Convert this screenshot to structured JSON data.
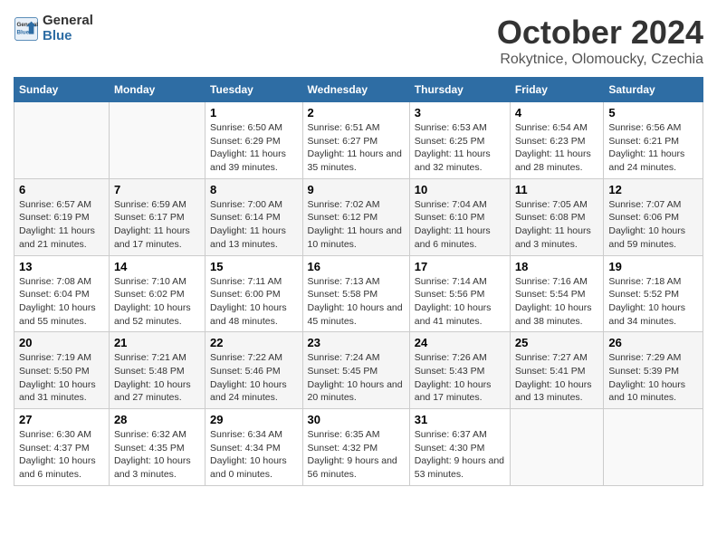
{
  "logo": {
    "line1": "General",
    "line2": "Blue"
  },
  "title": "October 2024",
  "subtitle": "Rokytnice, Olomoucky, Czechia",
  "days_of_week": [
    "Sunday",
    "Monday",
    "Tuesday",
    "Wednesday",
    "Thursday",
    "Friday",
    "Saturday"
  ],
  "weeks": [
    [
      {
        "day": "",
        "info": ""
      },
      {
        "day": "",
        "info": ""
      },
      {
        "day": "1",
        "info": "Sunrise: 6:50 AM\nSunset: 6:29 PM\nDaylight: 11 hours and 39 minutes."
      },
      {
        "day": "2",
        "info": "Sunrise: 6:51 AM\nSunset: 6:27 PM\nDaylight: 11 hours and 35 minutes."
      },
      {
        "day": "3",
        "info": "Sunrise: 6:53 AM\nSunset: 6:25 PM\nDaylight: 11 hours and 32 minutes."
      },
      {
        "day": "4",
        "info": "Sunrise: 6:54 AM\nSunset: 6:23 PM\nDaylight: 11 hours and 28 minutes."
      },
      {
        "day": "5",
        "info": "Sunrise: 6:56 AM\nSunset: 6:21 PM\nDaylight: 11 hours and 24 minutes."
      }
    ],
    [
      {
        "day": "6",
        "info": "Sunrise: 6:57 AM\nSunset: 6:19 PM\nDaylight: 11 hours and 21 minutes."
      },
      {
        "day": "7",
        "info": "Sunrise: 6:59 AM\nSunset: 6:17 PM\nDaylight: 11 hours and 17 minutes."
      },
      {
        "day": "8",
        "info": "Sunrise: 7:00 AM\nSunset: 6:14 PM\nDaylight: 11 hours and 13 minutes."
      },
      {
        "day": "9",
        "info": "Sunrise: 7:02 AM\nSunset: 6:12 PM\nDaylight: 11 hours and 10 minutes."
      },
      {
        "day": "10",
        "info": "Sunrise: 7:04 AM\nSunset: 6:10 PM\nDaylight: 11 hours and 6 minutes."
      },
      {
        "day": "11",
        "info": "Sunrise: 7:05 AM\nSunset: 6:08 PM\nDaylight: 11 hours and 3 minutes."
      },
      {
        "day": "12",
        "info": "Sunrise: 7:07 AM\nSunset: 6:06 PM\nDaylight: 10 hours and 59 minutes."
      }
    ],
    [
      {
        "day": "13",
        "info": "Sunrise: 7:08 AM\nSunset: 6:04 PM\nDaylight: 10 hours and 55 minutes."
      },
      {
        "day": "14",
        "info": "Sunrise: 7:10 AM\nSunset: 6:02 PM\nDaylight: 10 hours and 52 minutes."
      },
      {
        "day": "15",
        "info": "Sunrise: 7:11 AM\nSunset: 6:00 PM\nDaylight: 10 hours and 48 minutes."
      },
      {
        "day": "16",
        "info": "Sunrise: 7:13 AM\nSunset: 5:58 PM\nDaylight: 10 hours and 45 minutes."
      },
      {
        "day": "17",
        "info": "Sunrise: 7:14 AM\nSunset: 5:56 PM\nDaylight: 10 hours and 41 minutes."
      },
      {
        "day": "18",
        "info": "Sunrise: 7:16 AM\nSunset: 5:54 PM\nDaylight: 10 hours and 38 minutes."
      },
      {
        "day": "19",
        "info": "Sunrise: 7:18 AM\nSunset: 5:52 PM\nDaylight: 10 hours and 34 minutes."
      }
    ],
    [
      {
        "day": "20",
        "info": "Sunrise: 7:19 AM\nSunset: 5:50 PM\nDaylight: 10 hours and 31 minutes."
      },
      {
        "day": "21",
        "info": "Sunrise: 7:21 AM\nSunset: 5:48 PM\nDaylight: 10 hours and 27 minutes."
      },
      {
        "day": "22",
        "info": "Sunrise: 7:22 AM\nSunset: 5:46 PM\nDaylight: 10 hours and 24 minutes."
      },
      {
        "day": "23",
        "info": "Sunrise: 7:24 AM\nSunset: 5:45 PM\nDaylight: 10 hours and 20 minutes."
      },
      {
        "day": "24",
        "info": "Sunrise: 7:26 AM\nSunset: 5:43 PM\nDaylight: 10 hours and 17 minutes."
      },
      {
        "day": "25",
        "info": "Sunrise: 7:27 AM\nSunset: 5:41 PM\nDaylight: 10 hours and 13 minutes."
      },
      {
        "day": "26",
        "info": "Sunrise: 7:29 AM\nSunset: 5:39 PM\nDaylight: 10 hours and 10 minutes."
      }
    ],
    [
      {
        "day": "27",
        "info": "Sunrise: 6:30 AM\nSunset: 4:37 PM\nDaylight: 10 hours and 6 minutes."
      },
      {
        "day": "28",
        "info": "Sunrise: 6:32 AM\nSunset: 4:35 PM\nDaylight: 10 hours and 3 minutes."
      },
      {
        "day": "29",
        "info": "Sunrise: 6:34 AM\nSunset: 4:34 PM\nDaylight: 10 hours and 0 minutes."
      },
      {
        "day": "30",
        "info": "Sunrise: 6:35 AM\nSunset: 4:32 PM\nDaylight: 9 hours and 56 minutes."
      },
      {
        "day": "31",
        "info": "Sunrise: 6:37 AM\nSunset: 4:30 PM\nDaylight: 9 hours and 53 minutes."
      },
      {
        "day": "",
        "info": ""
      },
      {
        "day": "",
        "info": ""
      }
    ]
  ]
}
